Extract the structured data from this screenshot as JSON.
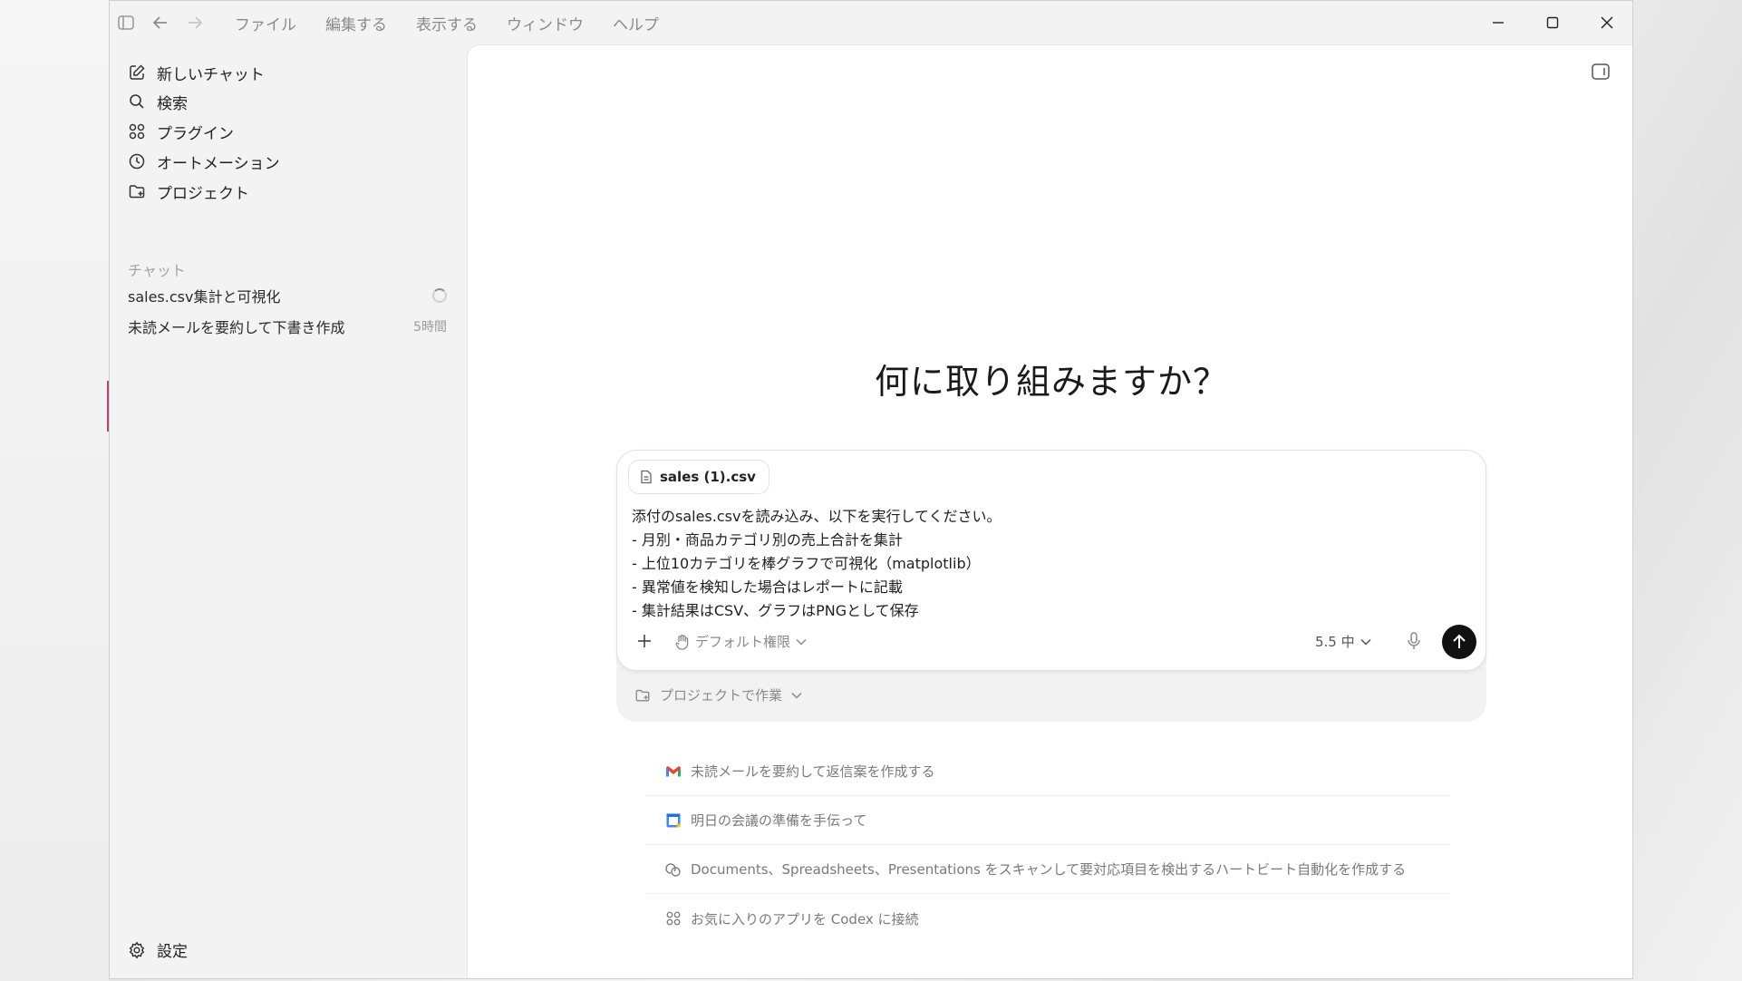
{
  "menu": [
    "ファイル",
    "編集する",
    "表示する",
    "ウィンドウ",
    "ヘルプ"
  ],
  "sidebar": {
    "nav": [
      {
        "label": "新しいチャット",
        "icon": "edit-icon"
      },
      {
        "label": "検索",
        "icon": "search-icon"
      },
      {
        "label": "プラグイン",
        "icon": "grid-icon"
      },
      {
        "label": "オートメーション",
        "icon": "clock-icon"
      },
      {
        "label": "プロジェクト",
        "icon": "folder-add-icon"
      }
    ],
    "section_label": "チャット",
    "chats": [
      {
        "title": "sales.csv集計と可視化",
        "time": ""
      },
      {
        "title": "未読メールを要約して下書き作成",
        "time": "5時間"
      }
    ],
    "settings_label": "設定"
  },
  "main": {
    "headline": "何に取り組みますか？",
    "attachment": "sales (1).csv",
    "prompt_lines": [
      "添付のsales.csvを読み込み、以下を実行してください。",
      "- 月別・商品カテゴリ別の売上合計を集計",
      "- 上位10カテゴリを棒グラフで可視化（matplotlib）",
      "- 異常値を検知した場合はレポートに記載",
      "- 集計結果はCSV、グラフはPNGとして保存"
    ],
    "permission_label": "デフォルト権限",
    "model_label": "5.5 中",
    "project_label": "プロジェクトで作業",
    "suggestions": [
      {
        "label": "未読メールを要約して返信案を作成する",
        "icon": "gmail-icon"
      },
      {
        "label": "明日の会議の準備を手伝って",
        "icon": "calendar-icon"
      },
      {
        "label": "Documents、Spreadsheets、Presentations をスキャンして要対応項目を検出するハートビート自動化を作成する",
        "icon": "chat-bubbles-icon"
      },
      {
        "label": "お気に入りのアプリを Codex に接続",
        "icon": "grid-icon"
      }
    ]
  },
  "colors": {
    "accent": "#111111",
    "sidebar_bg": "#f3f3f3"
  }
}
